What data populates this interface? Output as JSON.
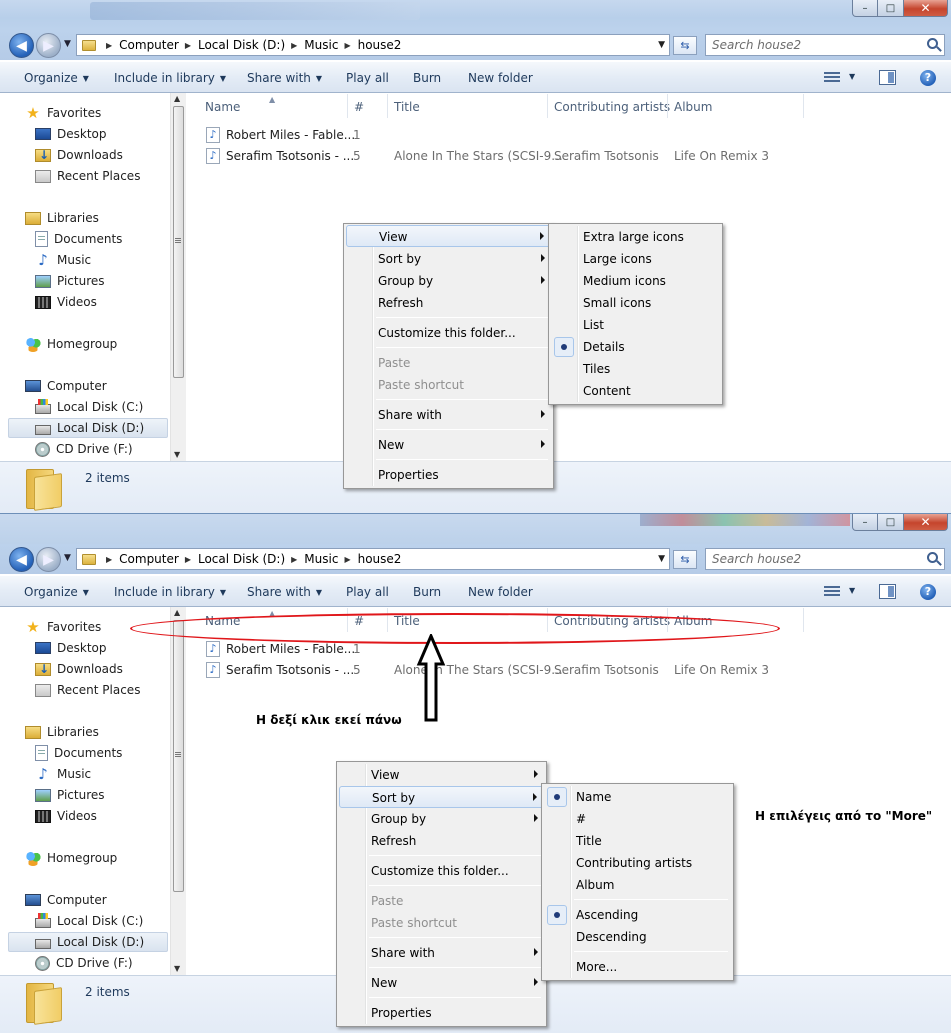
{
  "window": {
    "breadcrumb": [
      "Computer",
      "Local Disk (D:)",
      "Music",
      "house2"
    ],
    "search_placeholder": "Search house2",
    "btn_minimize": "–",
    "btn_maximize": "□",
    "btn_close": "✕"
  },
  "toolbar": {
    "organize": "Organize",
    "include_in_library": "Include in library",
    "share_with": "Share with",
    "play_all": "Play all",
    "burn": "Burn",
    "new_folder": "New folder",
    "help": "?"
  },
  "nav": {
    "favorites": "Favorites",
    "desktop": "Desktop",
    "downloads": "Downloads",
    "recent_places": "Recent Places",
    "libraries": "Libraries",
    "documents": "Documents",
    "music": "Music",
    "pictures": "Pictures",
    "videos": "Videos",
    "homegroup": "Homegroup",
    "computer": "Computer",
    "local_disk_c": "Local Disk (C:)",
    "local_disk_d": "Local Disk (D:)",
    "cd_drive": "CD Drive (F:)"
  },
  "columns": {
    "name": "Name",
    "number": "#",
    "title": "Title",
    "artists": "Contributing artists",
    "album": "Album"
  },
  "files": [
    {
      "name": "Robert Miles - Fable...",
      "number": "1",
      "title": "",
      "artists": "",
      "album": ""
    },
    {
      "name": "Serafim Tsotsonis - ...",
      "number": "5",
      "title": "Alone In The Stars (SCSI-9...",
      "artists": "Serafim Tsotsonis",
      "album": "Life On Remix 3"
    }
  ],
  "status": {
    "item_count": "2 items"
  },
  "context_menu": {
    "view": "View",
    "sort_by": "Sort by",
    "group_by": "Group by",
    "refresh": "Refresh",
    "customize": "Customize this folder...",
    "paste": "Paste",
    "paste_shortcut": "Paste shortcut",
    "share_with": "Share with",
    "new": "New",
    "properties": "Properties"
  },
  "view_submenu": {
    "extra_large_icons": "Extra large icons",
    "large_icons": "Large icons",
    "medium_icons": "Medium icons",
    "small_icons": "Small icons",
    "list": "List",
    "details": "Details",
    "tiles": "Tiles",
    "content": "Content"
  },
  "sort_submenu": {
    "name": "Name",
    "number": "#",
    "title": "Title",
    "artists": "Contributing artists",
    "album": "Album",
    "ascending": "Ascending",
    "descending": "Descending",
    "more": "More..."
  },
  "annotations": {
    "right_click_here": "Η δεξί κλικ εκεί πάνω",
    "more_options": "Η επιλέγεις από το \"More\""
  },
  "colors": {
    "annotation_red": "#e0161a",
    "link_blue": "#1e395b"
  }
}
